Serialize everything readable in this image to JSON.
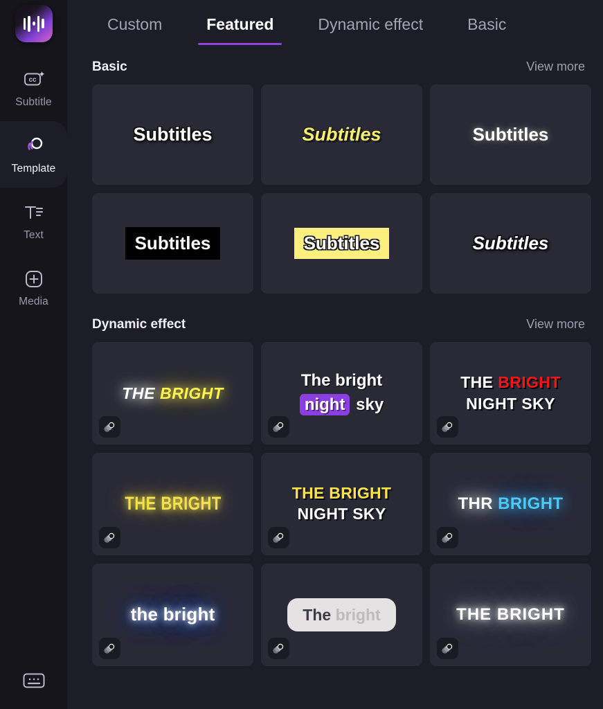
{
  "app": {
    "logo_icon": "waveform-logo-icon",
    "accent_color": "#8b46d4",
    "sidebar_bg": "#16151b",
    "panel_bg": "#1d1d28",
    "card_bg": "#2a2a37"
  },
  "sidebar": {
    "items": [
      {
        "label": "Subtitle",
        "icon": "closed-caption-sparkle-icon",
        "active": false
      },
      {
        "label": "Template",
        "icon": "template-circles-icon",
        "active": true
      },
      {
        "label": "Text",
        "icon": "text-lines-icon",
        "active": false
      },
      {
        "label": "Media",
        "icon": "media-plus-icon",
        "active": false
      }
    ],
    "bottom": {
      "icon": "keyboard-icon",
      "label": ""
    }
  },
  "tabs": [
    {
      "label": "Custom",
      "active": false
    },
    {
      "label": "Featured",
      "active": true
    },
    {
      "label": "Dynamic effect",
      "active": false
    },
    {
      "label": "Basic",
      "active": false
    }
  ],
  "sections": [
    {
      "title": "Basic",
      "view_more": "View more",
      "cards": [
        {
          "style": "s-outline-white",
          "text": "Subtitles",
          "name": "template-subtitles-outline-white"
        },
        {
          "style": "s-yellow-italic",
          "text": "Subtitles",
          "name": "template-subtitles-yellow-italic"
        },
        {
          "style": "s-glow-white",
          "text": "Subtitles",
          "name": "template-subtitles-glow-white"
        },
        {
          "style": "s-blackbox",
          "text": "Subtitles",
          "name": "template-subtitles-black-box"
        },
        {
          "style": "s-yellowbox",
          "text": "Subtitles",
          "name": "template-subtitles-yellow-box"
        },
        {
          "style": "s-italic-outline",
          "text": "Subtitles",
          "name": "template-subtitles-italic-outline"
        }
      ]
    },
    {
      "title": "Dynamic effect",
      "view_more": "View more",
      "cards": [
        {
          "style": "d-neon-duo",
          "name": "template-the-bright-neon-duo",
          "badge": "layers-badge-icon",
          "parts": [
            {
              "cls": "w",
              "text": "THE "
            },
            {
              "cls": "y",
              "text": "BRIGHT"
            }
          ]
        },
        {
          "style": "d-highlight",
          "name": "template-night-sky-highlight",
          "badge": "layers-badge-icon",
          "lines": [
            [
              {
                "cls": "",
                "text": "The bright"
              }
            ],
            [
              {
                "cls": "hl",
                "text": "night"
              },
              {
                "cls": "",
                "text": " sky"
              }
            ]
          ]
        },
        {
          "style": "d-redwhite",
          "name": "template-the-bright-red-white",
          "badge": "layers-badge-icon",
          "lines": [
            [
              {
                "cls": "w",
                "text": "THE "
              },
              {
                "cls": "r",
                "text": "BRIGHT"
              }
            ],
            [
              {
                "cls": "w",
                "text": "NIGHT SKY"
              }
            ]
          ]
        },
        {
          "style": "d-neon-yellow",
          "name": "template-the-bright-neon-yellow",
          "badge": "layers-badge-icon",
          "text": "THE BRIGHT"
        },
        {
          "style": "d-yellow-white",
          "name": "template-the-bright-yellow-white",
          "badge": "layers-badge-icon",
          "lines": [
            [
              {
                "cls": "y",
                "text": "THE BRIGHT"
              }
            ],
            [
              {
                "cls": "w",
                "text": "NIGHT SKY"
              }
            ]
          ]
        },
        {
          "style": "d-cyanglow",
          "name": "template-thr-bright-cyan-glow",
          "badge": "layers-badge-icon",
          "parts": [
            {
              "cls": "w",
              "text": "THR "
            },
            {
              "cls": "c",
              "text": "BRIGHT"
            }
          ]
        },
        {
          "style": "d-blueglow",
          "name": "template-the-bright-blue-glow",
          "badge": "layers-badge-icon",
          "text": "the bright"
        },
        {
          "style": "d-pill",
          "name": "template-the-bright-light-pill",
          "badge": "layers-badge-icon",
          "parts": [
            {
              "cls": "dk",
              "text": "The "
            },
            {
              "cls": "gy",
              "text": " bright"
            }
          ]
        },
        {
          "style": "d-whiteglow",
          "name": "template-the-bright-white-glow",
          "badge": "layers-badge-icon",
          "text": "THE BRIGHT"
        }
      ]
    }
  ]
}
